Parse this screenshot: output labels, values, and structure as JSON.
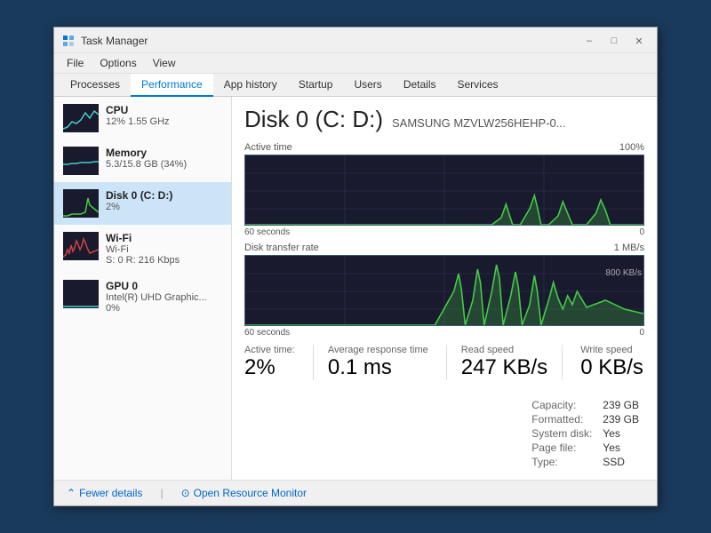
{
  "window": {
    "title": "Task Manager",
    "minimize_label": "–",
    "maximize_label": "□",
    "close_label": "✕"
  },
  "menu": {
    "file": "File",
    "options": "Options",
    "view": "View"
  },
  "tabs": [
    {
      "id": "processes",
      "label": "Processes"
    },
    {
      "id": "performance",
      "label": "Performance",
      "active": true
    },
    {
      "id": "app-history",
      "label": "App history"
    },
    {
      "id": "startup",
      "label": "Startup"
    },
    {
      "id": "users",
      "label": "Users"
    },
    {
      "id": "details",
      "label": "Details"
    },
    {
      "id": "services",
      "label": "Services"
    }
  ],
  "sidebar": {
    "items": [
      {
        "id": "cpu",
        "name": "CPU",
        "detail1": "12% 1.55 GHz",
        "detail2": ""
      },
      {
        "id": "memory",
        "name": "Memory",
        "detail1": "5.3/15.8 GB (34%)",
        "detail2": ""
      },
      {
        "id": "disk",
        "name": "Disk 0 (C: D:)",
        "detail1": "2%",
        "detail2": "",
        "active": true
      },
      {
        "id": "wifi",
        "name": "Wi-Fi",
        "detail1": "Wi-Fi",
        "detail2": "S: 0  R: 216 Kbps"
      },
      {
        "id": "gpu",
        "name": "GPU 0",
        "detail1": "Intel(R) UHD Graphic...",
        "detail2": "0%"
      }
    ]
  },
  "main": {
    "disk_title": "Disk 0 (C: D:)",
    "disk_model": "SAMSUNG MZVLW256HEHP-0...",
    "active_time_label": "Active time",
    "active_time_max": "100%",
    "transfer_rate_label": "Disk transfer rate",
    "transfer_rate_max": "1 MB/s",
    "transfer_rate_mid": "800 KB/s",
    "time_label": "60 seconds",
    "time_value_right": "0",
    "stats": {
      "active_time_label": "Active time:",
      "active_time_value": "2%",
      "avg_response_label": "Average response time",
      "avg_response_value": "0.1 ms",
      "read_speed_label": "Read speed",
      "read_speed_value": "247 KB/s",
      "write_speed_label": "Write speed",
      "write_speed_value": "0 KB/s"
    },
    "right_stats": {
      "capacity_label": "Capacity:",
      "capacity_value": "239 GB",
      "formatted_label": "Formatted:",
      "formatted_value": "239 GB",
      "system_disk_label": "System disk:",
      "system_disk_value": "Yes",
      "page_file_label": "Page file:",
      "page_file_value": "Yes",
      "type_label": "Type:",
      "type_value": "SSD"
    }
  },
  "footer": {
    "fewer_details_label": "Fewer details",
    "resource_monitor_label": "Open Resource Monitor"
  }
}
